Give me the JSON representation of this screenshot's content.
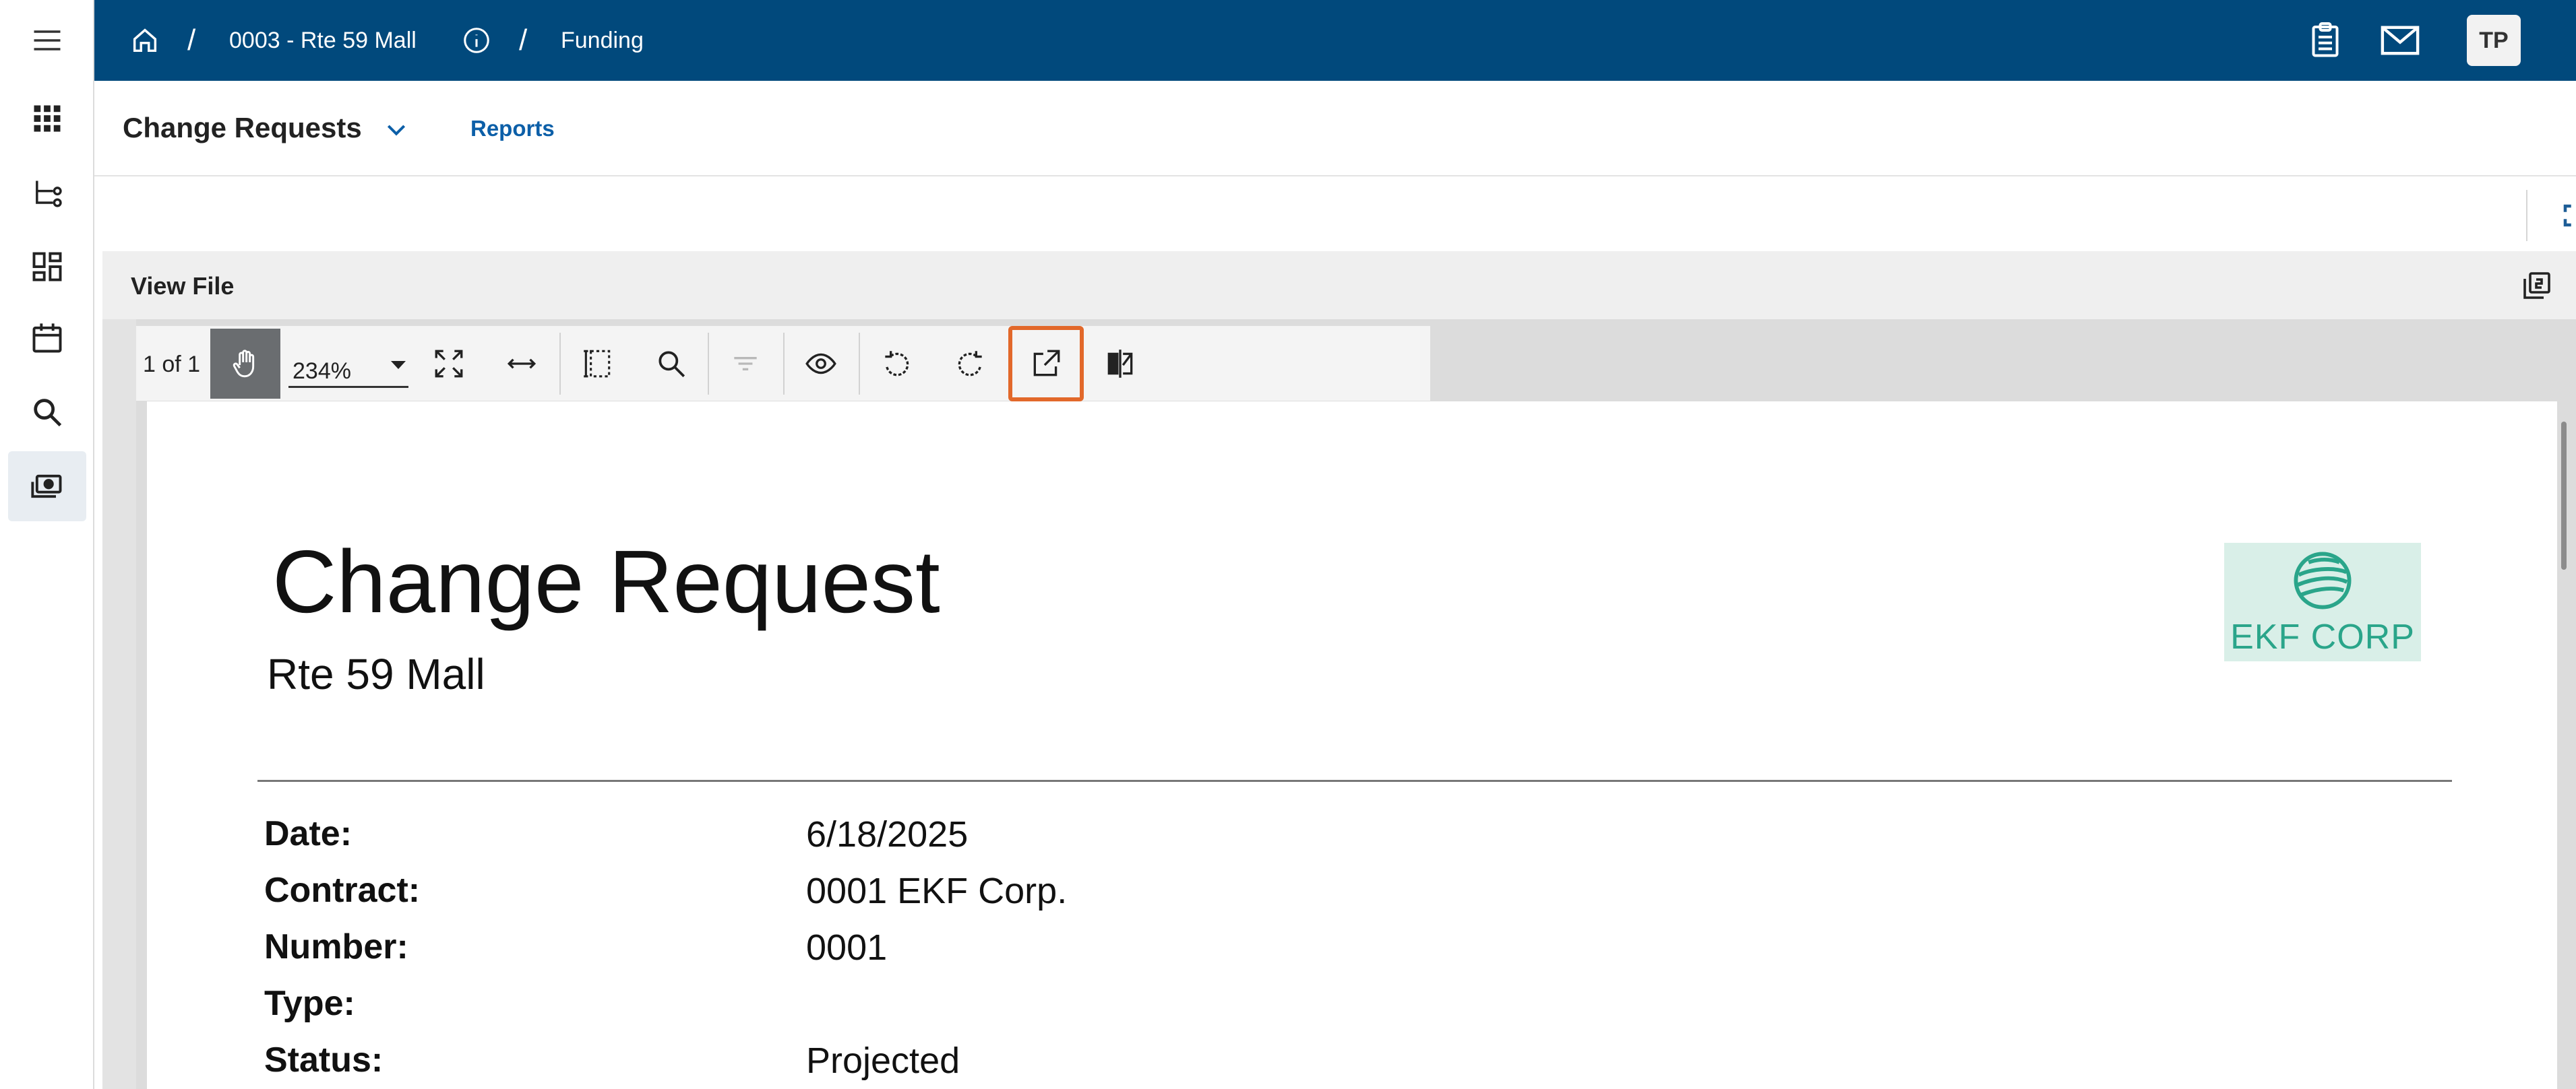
{
  "breadcrumb": {
    "project": "0003 - Rte 59 Mall",
    "current": "Funding"
  },
  "header": {
    "avatar_initials": "TP"
  },
  "module": {
    "title": "Change Requests",
    "reports_link": "Reports"
  },
  "panel": {
    "title": "View File"
  },
  "viewer": {
    "page_indicator": "1 of 1",
    "zoom": "234%"
  },
  "document": {
    "title": "Change Request",
    "subtitle": "Rte 59 Mall",
    "logo_text": "EKF CORP",
    "fields": [
      {
        "label": "Date:",
        "value": "6/18/2025"
      },
      {
        "label": "Contract:",
        "value": "0001 EKF Corp."
      },
      {
        "label": "Number:",
        "value": "0001"
      },
      {
        "label": "Type:",
        "value": ""
      },
      {
        "label": "Status:",
        "value": "Projected"
      }
    ]
  },
  "colors": {
    "topbar": "#01497c",
    "link": "#0c5fa8",
    "highlight": "#e2682a",
    "logo_green": "#2aa58a"
  }
}
